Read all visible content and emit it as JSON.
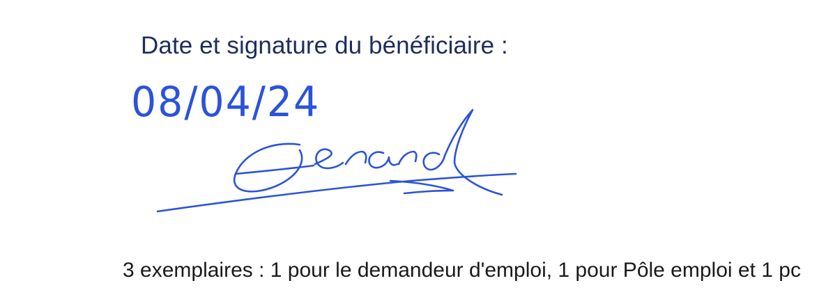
{
  "signature_block": {
    "label": "Date et signature du bénéficiaire :",
    "handwritten_date": "08/04/24",
    "signature_name": "Gerard",
    "ink_color": "#2b53d9"
  },
  "footer": {
    "copies_text": "3 exemplaires : 1 pour le demandeur d'emploi, 1 pour Pôle emploi et 1 pc"
  }
}
